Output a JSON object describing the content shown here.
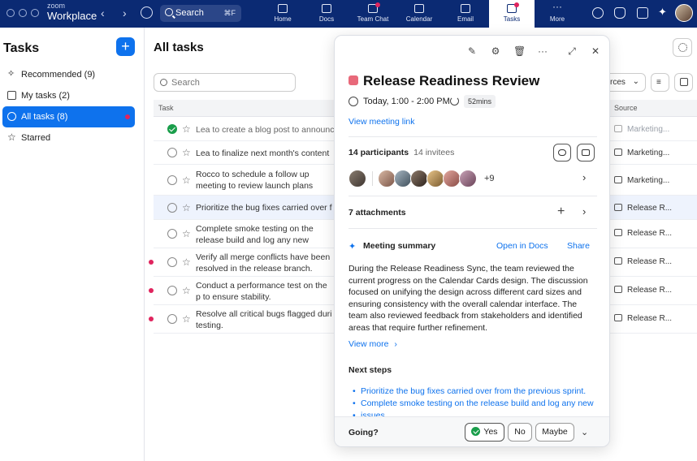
{
  "topbar": {
    "brand_small": "zoom",
    "brand": "Workplace",
    "search_label": "Search",
    "search_shortcut": "⌘F",
    "tabs": [
      {
        "label": "Home"
      },
      {
        "label": "Docs"
      },
      {
        "label": "Team Chat"
      },
      {
        "label": "Calendar"
      },
      {
        "label": "Email"
      },
      {
        "label": "Tasks"
      },
      {
        "label": "More"
      }
    ]
  },
  "sidebar": {
    "title": "Tasks",
    "add_label": "+",
    "items": [
      {
        "label": "Recommended (9)"
      },
      {
        "label": "My tasks (2)"
      },
      {
        "label": "All tasks (8)"
      },
      {
        "label": "Starred"
      }
    ]
  },
  "main": {
    "title": "All tasks",
    "search_placeholder": "Search",
    "col_task": "Task",
    "col_source": "Source",
    "sources_partial": "rces",
    "rows": [
      {
        "title": "Lea to create a blog post to announce",
        "source": "Marketing..."
      },
      {
        "title": "Lea to finalize next month's content",
        "source": "Marketing..."
      },
      {
        "title": "Rocco to schedule a follow up meeting to review launch plans",
        "source": "Marketing..."
      },
      {
        "title": "Prioritize the bug fixes carried over f",
        "source": "Release R..."
      },
      {
        "title": "Complete smoke testing on the release build and log any new issues.",
        "source": "Release R..."
      },
      {
        "title": "Verify all merge conflicts have been resolved in the release branch.",
        "source": "Release R..."
      },
      {
        "title": "Conduct a performance test on the p to ensure stability.",
        "source": "Release R..."
      },
      {
        "title": "Resolve all critical bugs flagged duri testing.",
        "source": "Release R..."
      }
    ]
  },
  "panel": {
    "title": "Release Readiness Review",
    "time": "Today, 1:00 - 2:00 PM",
    "duration": "52mins",
    "meeting_link": "View meeting link",
    "participants": "14 participants",
    "invitees": "14 invitees",
    "more_count": "+9",
    "attachments": "7 attachments",
    "summary_title": "Meeting summary",
    "open_docs": "Open in Docs",
    "share": "Share",
    "summary_body": "During the Release Readiness Sync, the team reviewed the current progress on the Calendar Cards design. The discussion focused on unifying the design across different card sizes and ensuring consistency with the overall calendar interface. The team also reviewed feedback from stakeholders and identified areas that require further refinement.",
    "view_more": "View more",
    "next_steps_title": "Next steps",
    "next_steps": [
      "Prioritize the bug fixes carried over from the previous sprint.",
      "Complete smoke testing on the release build and log any new",
      "issues."
    ],
    "going_label": "Going?",
    "rsvp_yes": "Yes",
    "rsvp_no": "No",
    "rsvp_maybe": "Maybe"
  },
  "colors": {
    "topbar": "#0b2a73",
    "accent": "#0e72ed",
    "event": "#e8697a",
    "done": "#1a9e4b",
    "alert": "#e0245e"
  }
}
